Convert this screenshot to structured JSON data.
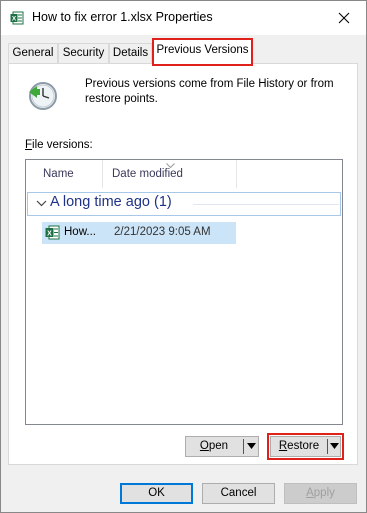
{
  "window": {
    "title": "How to fix error 1.xlsx Properties"
  },
  "tabs": [
    {
      "label": "General"
    },
    {
      "label": "Security"
    },
    {
      "label": "Details"
    },
    {
      "label": "Previous Versions"
    }
  ],
  "panel": {
    "info_text": "Previous versions come from File History or from restore points.",
    "file_versions_label": "ile versions:",
    "file_versions_mnemonic": "F",
    "columns": [
      {
        "label": "Name"
      },
      {
        "label": "Date modified"
      }
    ],
    "group": {
      "title": "A long time ago (1)"
    },
    "files": [
      {
        "name": "How...",
        "date": "2/21/2023 9:05 AM"
      }
    ],
    "open_button": {
      "mnemonic": "O",
      "rest": "pen"
    },
    "restore_button": {
      "mnemonic": "R",
      "rest": "estore"
    }
  },
  "footer": {
    "ok_label": "OK",
    "cancel_label": "Cancel",
    "apply_mnemonic": "A",
    "apply_rest": "pply"
  },
  "colors": {
    "highlight": "#e0201b",
    "selection": "#cce4f7",
    "group_text": "#1e3287",
    "excel_green": "#1d7044"
  },
  "icons": [
    "excel-file-icon",
    "close-icon",
    "history-clock-icon",
    "chevron-down-icon",
    "dropdown-arrow-icon"
  ]
}
